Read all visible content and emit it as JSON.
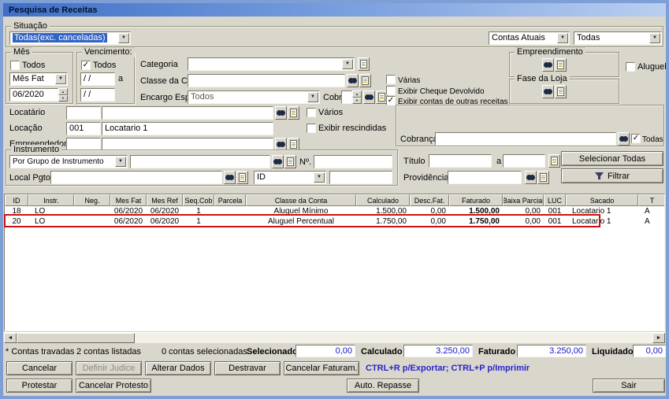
{
  "window": {
    "title": "Pesquisa de Receitas"
  },
  "icons": {
    "dropdown": "▼",
    "check": "✓",
    "scroll_left": "◄",
    "scroll_right": "►",
    "spin_up": "▲",
    "spin_down": "▼"
  },
  "situacao": {
    "legend": "Situação",
    "value": "Todas(exc. canceladas)"
  },
  "filtros_topo": {
    "contas_atuais": "Contas Atuais",
    "todas": "Todas"
  },
  "mes": {
    "legend": "Mês",
    "todos": "Todos",
    "tipo": "Mês Fat",
    "periodo": "06/2020"
  },
  "vencimento": {
    "legend": "Vencimento:",
    "todos": "Todos",
    "data_inicial": "/ /",
    "a": "a",
    "data_final": "/ /"
  },
  "categoria": {
    "label": "Categoria",
    "value": ""
  },
  "classe_conta": {
    "label": "Classe da Conta",
    "value": "",
    "varias": "Várias"
  },
  "encargo": {
    "label": "Encargo Espec.",
    "value": "Todos",
    "cobr": "Cobr",
    "cobr_value": ""
  },
  "opcoes": {
    "exibir_cheque": "Exibir Cheque Devolvido",
    "exibir_outras": "Exibir contas de outras receitas"
  },
  "empreendimento": {
    "legend": "Empreendimento",
    "aluguel": "Aluguel"
  },
  "fase_loja": {
    "legend": "Fase da Loja"
  },
  "locatario": {
    "label": "Locatário",
    "codigo": "",
    "nome": "",
    "varios": "Vários"
  },
  "locacao": {
    "label": "Locação",
    "codigo": "001",
    "nome": "Locatario 1",
    "exibir_rescindidas": "Exibir rescindidas"
  },
  "empreendedor": {
    "label": "Empreendedor",
    "codigo": "",
    "nome": ""
  },
  "cobranca": {
    "label": "Cobrança",
    "value": "",
    "todas": "Todas"
  },
  "instrumento": {
    "legend": "Instrumento",
    "grupo": "Por Grupo de Instrumento",
    "valor": "",
    "numero_label": "Nº.",
    "numero": "",
    "local_pgto": "Local Pgto",
    "local_pgto_value": "",
    "id_label": "ID",
    "id_value": ""
  },
  "titulo": {
    "label": "Título",
    "de": "",
    "a": "a",
    "ate": ""
  },
  "providencia": {
    "label": "Providência",
    "value": ""
  },
  "acoes": {
    "selecionar_todas": "Selecionar Todas",
    "filtrar": "Filtrar"
  },
  "grid": {
    "columns": [
      "ID",
      "Instr.",
      "Neg.",
      "Mes Fat",
      "Mes Ref",
      "Seq.Cob",
      "Parcela",
      "Classe da Conta",
      "Calculado",
      "Desc.Fat.",
      "Faturado",
      "Baixa Parcial",
      "LUC",
      "Sacado",
      "T"
    ],
    "rows": [
      [
        "18",
        "LO",
        "",
        "06/2020",
        "06/2020",
        "1",
        "",
        "Aluguel Mínimo",
        "1.500,00",
        "0,00",
        "1.500,00",
        "0,00",
        "001",
        "Locatario 1",
        "A"
      ],
      [
        "20",
        "LO",
        "",
        "06/2020",
        "06/2020",
        "1",
        "",
        "Aluguel Percentual",
        "1.750,00",
        "0,00",
        "1.750,00",
        "0,00",
        "001",
        "Locatario 1",
        "A"
      ]
    ]
  },
  "status": {
    "travadas": "* Contas travadas",
    "listadas": "2 contas listadas",
    "selecionadas": "0 contas selecionadas",
    "selecionado_label": "Selecionado",
    "selecionado": "0,00",
    "calculado_label": "Calculado",
    "calculado": "3.250,00",
    "faturado_label": "Faturado",
    "faturado": "3.250,00",
    "liquidado_label": "Liquidado",
    "liquidado": "0,00"
  },
  "botoes": {
    "cancelar": "Cancelar",
    "definir_judice": "Definir Judice",
    "alterar_dados": "Alterar Dados",
    "destravar": "Destravar",
    "cancelar_faturam": "Cancelar Faturam.",
    "atalhos": "CTRL+R p/Exportar; CTRL+P p/Imprimir",
    "protestar": "Protestar",
    "cancelar_protesto": "Cancelar Protesto",
    "auto_repasse": "Auto. Repasse",
    "sair": "Sair"
  }
}
